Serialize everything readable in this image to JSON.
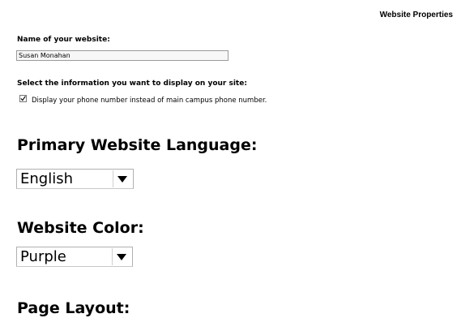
{
  "header": {
    "title": "Website Properties"
  },
  "name_field": {
    "label": "Name of your website:",
    "value": "Susan Monahan"
  },
  "display_info": {
    "label": "Select the information you want to display on your site:",
    "checkbox_label": "Display your phone number instead of main campus phone number.",
    "checked": true
  },
  "language": {
    "heading": "Primary Website Language:",
    "selected": "English"
  },
  "color": {
    "heading": "Website Color:",
    "selected": "Purple"
  },
  "layout": {
    "heading": "Page Layout:"
  },
  "icons": {
    "checkmark": "checkmark-icon",
    "dropdown": "dropdown-arrow-icon"
  }
}
